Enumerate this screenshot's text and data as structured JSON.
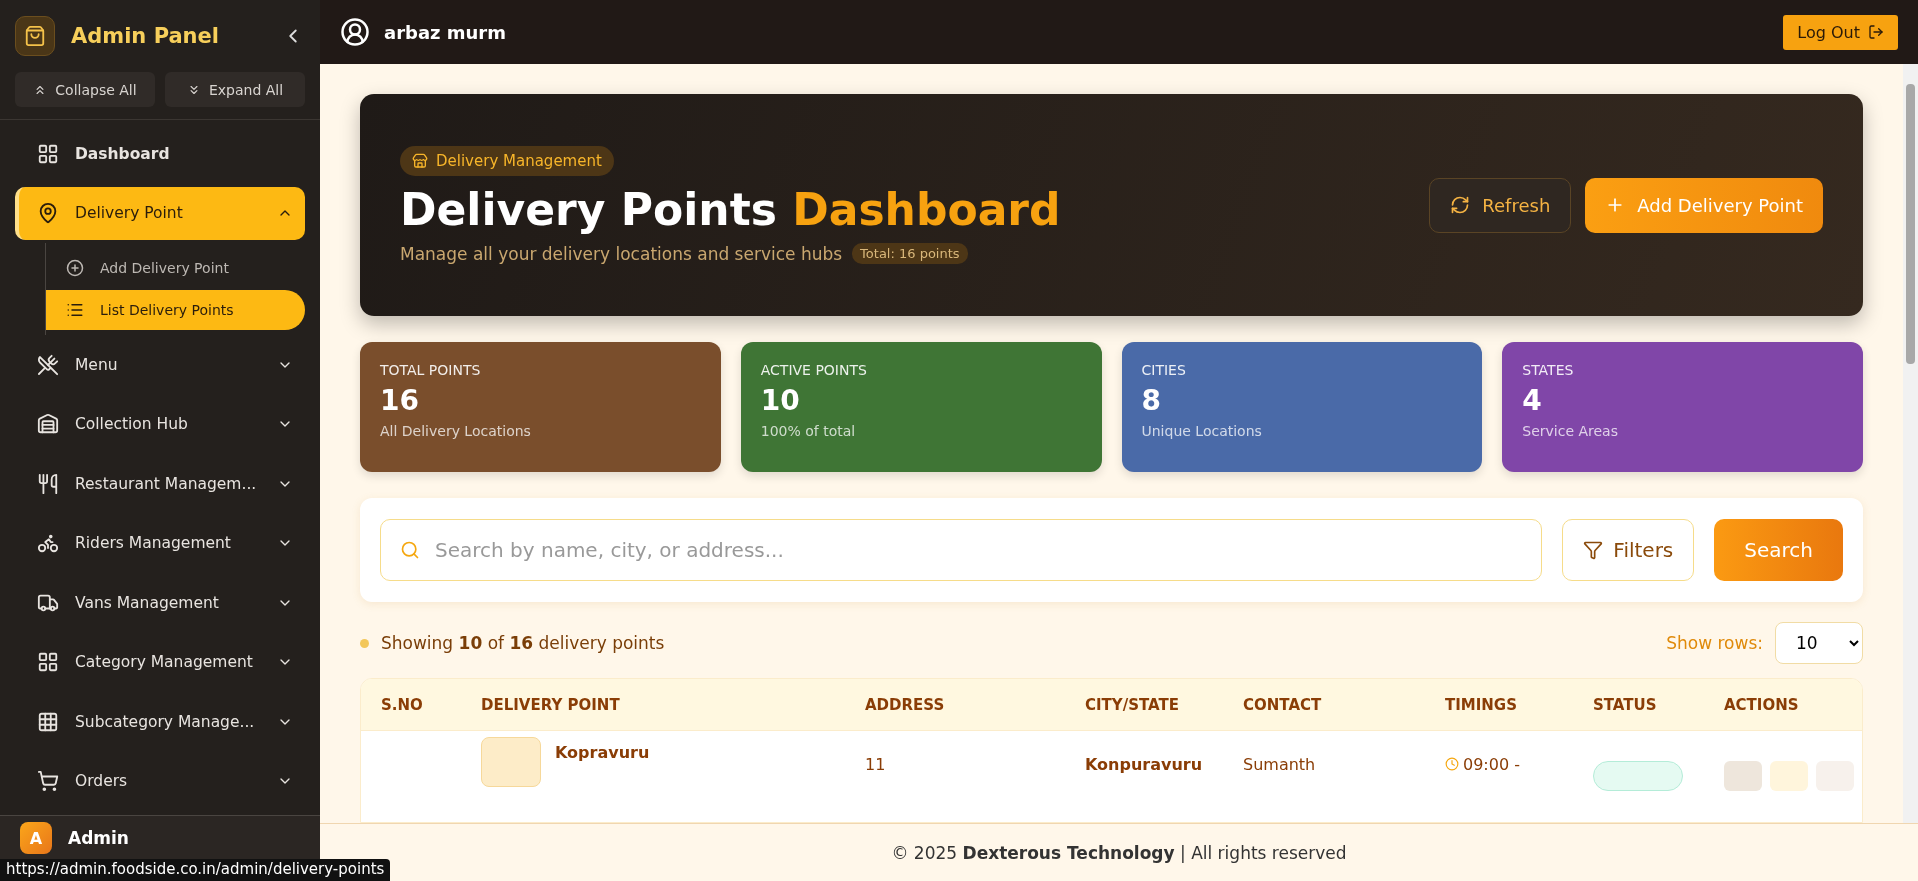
{
  "sidebar": {
    "title": "Admin Panel",
    "collapse_label": "Collapse All",
    "expand_label": "Expand All",
    "items": [
      {
        "label": "Dashboard",
        "kind": "link",
        "selected": false
      },
      {
        "label": "Delivery Point",
        "kind": "group",
        "expanded": true,
        "selected": true,
        "children": [
          {
            "label": "Add Delivery Point",
            "selected": false
          },
          {
            "label": "List Delivery Points",
            "selected": true
          }
        ]
      },
      {
        "label": "Menu",
        "kind": "group",
        "expanded": false,
        "selected": false
      },
      {
        "label": "Collection Hub",
        "kind": "group",
        "expanded": false,
        "selected": false
      },
      {
        "label": "Restaurant Managem...",
        "kind": "group",
        "expanded": false,
        "selected": false
      },
      {
        "label": "Riders Management",
        "kind": "group",
        "expanded": false,
        "selected": false
      },
      {
        "label": "Vans Management",
        "kind": "group",
        "expanded": false,
        "selected": false
      },
      {
        "label": "Category Management",
        "kind": "group",
        "expanded": false,
        "selected": false
      },
      {
        "label": "Subcategory Manage...",
        "kind": "group",
        "expanded": false,
        "selected": false
      },
      {
        "label": "Orders",
        "kind": "group",
        "expanded": false,
        "selected": false
      }
    ],
    "user": {
      "initial": "A",
      "name": "Admin"
    }
  },
  "topbar": {
    "username": "arbaz murm",
    "logout": "Log Out"
  },
  "hero": {
    "badge": "Delivery Management",
    "title": "Delivery Points",
    "title_accent": "Dashboard",
    "subtitle": "Manage all your delivery locations and service hubs",
    "total": "Total: 16 points",
    "refresh": "Refresh",
    "add": "Add Delivery Point"
  },
  "stats": [
    {
      "label": "TOTAL POINTS",
      "value": "16",
      "caption": "All Delivery Locations",
      "color": "#7a4e2c"
    },
    {
      "label": "ACTIVE POINTS",
      "value": "10",
      "caption": "100% of total",
      "color": "#3f7535"
    },
    {
      "label": "CITIES",
      "value": "8",
      "caption": "Unique Locations",
      "color": "#4a6aa8"
    },
    {
      "label": "STATES",
      "value": "4",
      "caption": "Service Areas",
      "color": "#8046a8"
    }
  ],
  "search": {
    "placeholder": "Search by name, city, or address...",
    "filters": "Filters",
    "button": "Search"
  },
  "summary": {
    "text": "Showing **10** of **16** delivery points",
    "rows_label": "Show rows:",
    "rows_value": "10"
  },
  "table": {
    "columns": [
      "S.NO",
      "DELIVERY POINT",
      "ADDRESS",
      "CITY/STATE",
      "CONTACT",
      "TIMINGS",
      "STATUS",
      "ACTIONS"
    ],
    "rows": [
      {
        "name": "Kopravuru",
        "address": "11",
        "city": "Konpuravuru",
        "contact": "Sumanth",
        "timing": "09:00 -"
      }
    ]
  },
  "footer": "© 2025 **Dexterous Technology** | All rights reserved",
  "browser_status_url": "https://admin.foodside.co.in/admin/delivery-points"
}
